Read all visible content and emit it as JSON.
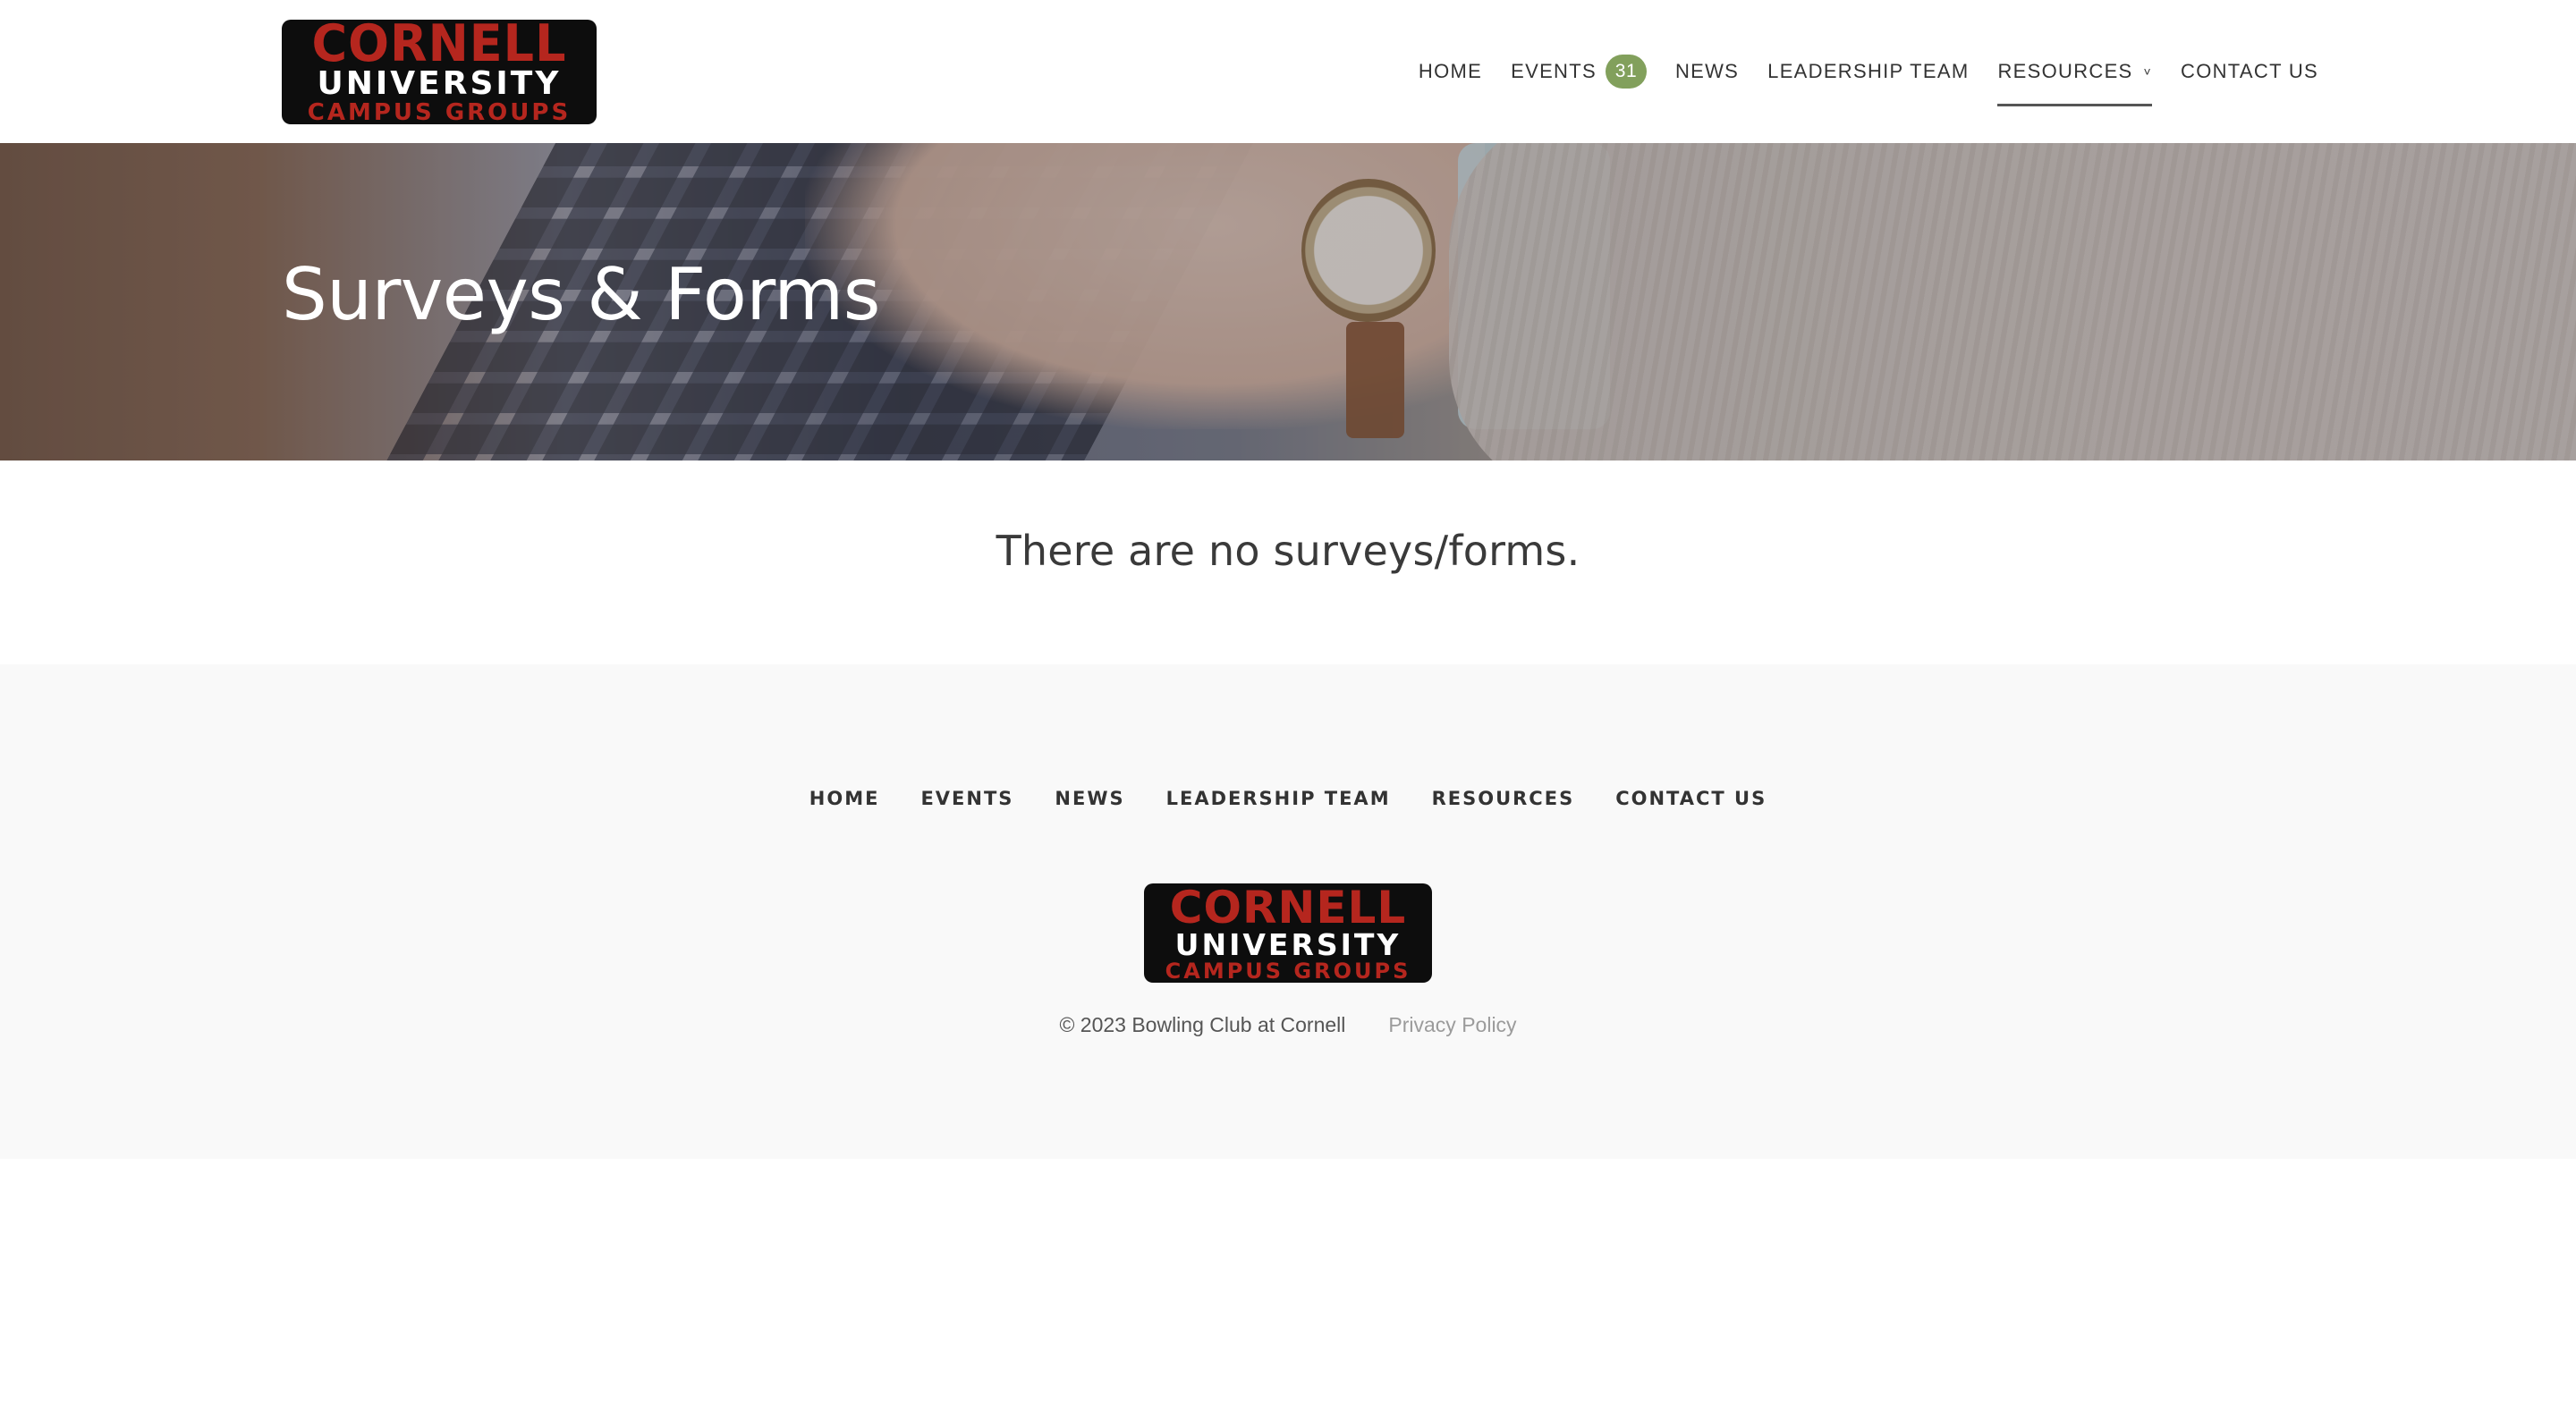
{
  "header": {
    "logo": {
      "line1": "CORNELL",
      "line2": "UNIVERSITY",
      "line3": "CAMPUS GROUPS"
    },
    "nav": [
      {
        "label": "HOME"
      },
      {
        "label": "EVENTS",
        "badge": "31"
      },
      {
        "label": "NEWS"
      },
      {
        "label": "LEADERSHIP TEAM"
      },
      {
        "label": "RESOURCES",
        "caret": "˅"
      },
      {
        "label": "CONTACT US"
      }
    ],
    "active_item": "RESOURCES",
    "badge_color": "#82a05c"
  },
  "hero": {
    "title": "Surveys & Forms"
  },
  "main": {
    "empty_message": "There are no surveys/forms."
  },
  "footer": {
    "nav": [
      {
        "label": "HOME"
      },
      {
        "label": "EVENTS"
      },
      {
        "label": "NEWS"
      },
      {
        "label": "LEADERSHIP TEAM"
      },
      {
        "label": "RESOURCES"
      },
      {
        "label": "CONTACT US"
      }
    ],
    "logo": {
      "line1": "CORNELL",
      "line2": "UNIVERSITY",
      "line3": "CAMPUS GROUPS"
    },
    "copyright": "© 2023 Bowling Club at Cornell",
    "privacy_link": "Privacy Policy"
  },
  "colors": {
    "logo_red": "#b5261e",
    "logo_bg": "#0d0d0d",
    "footer_bg": "#f9f9f9"
  }
}
